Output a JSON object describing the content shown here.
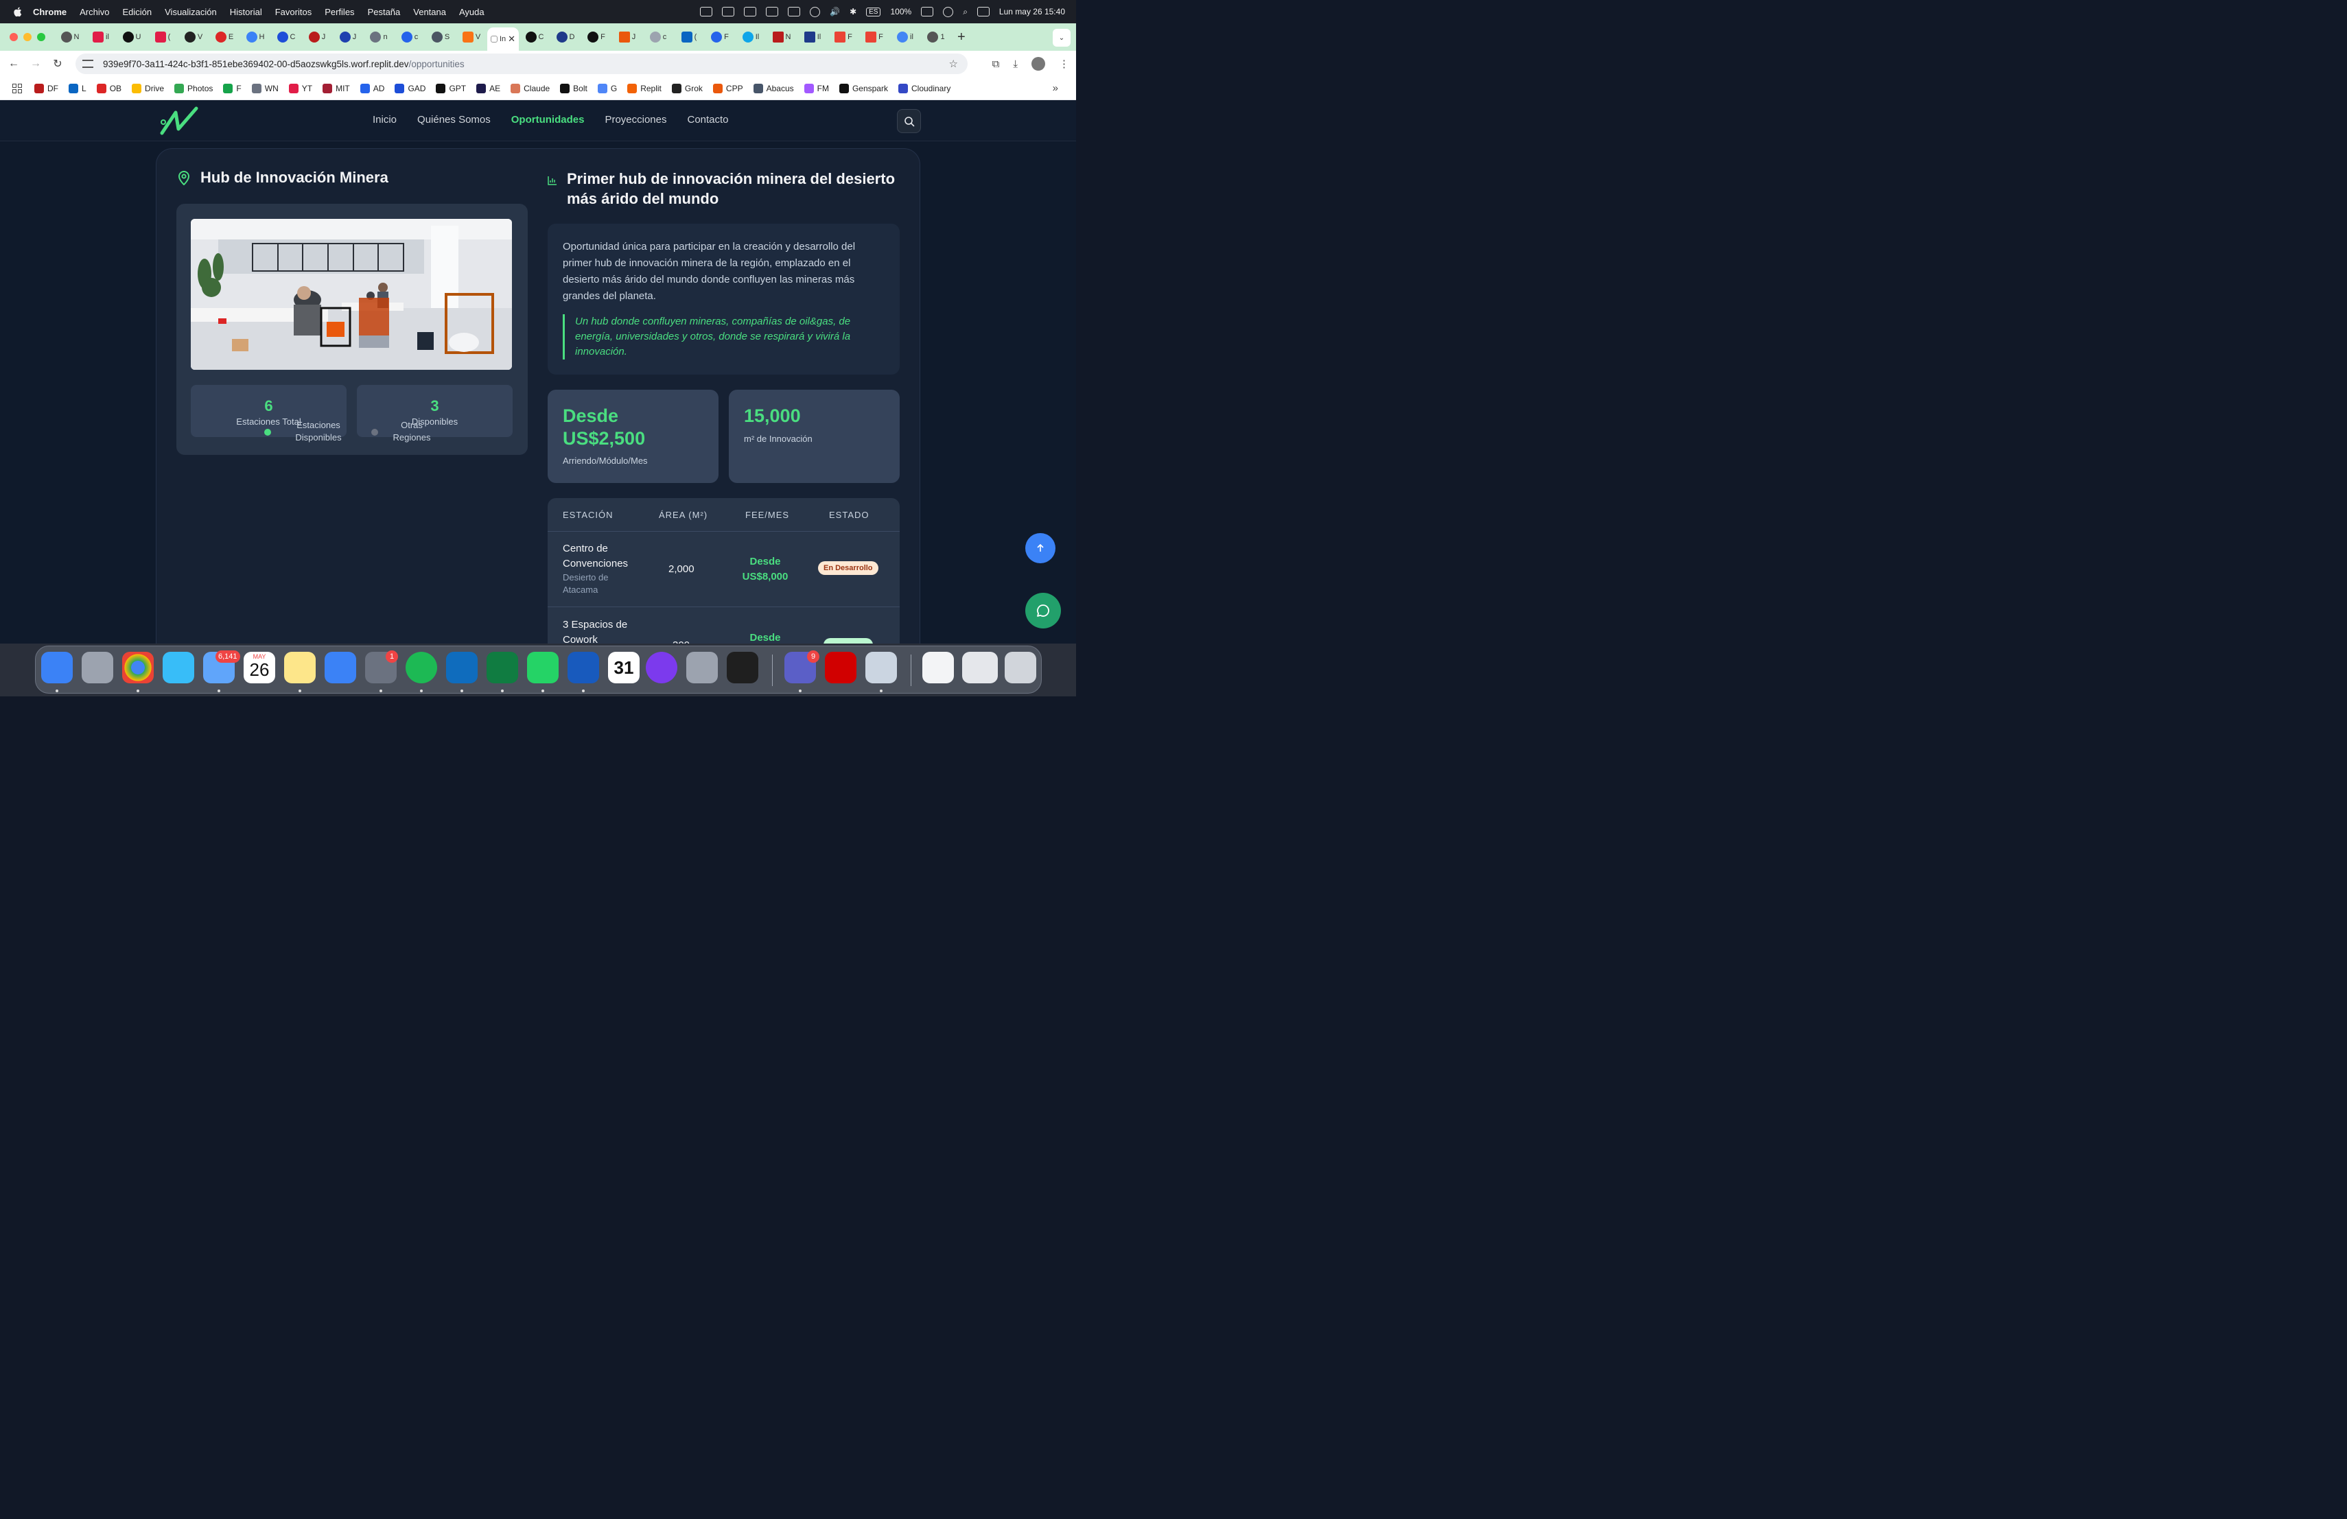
{
  "menubar": {
    "app_name": "Chrome",
    "menus": [
      "Archivo",
      "Edición",
      "Visualización",
      "Historial",
      "Favoritos",
      "Perfiles",
      "Pestaña",
      "Ventana",
      "Ayuda"
    ],
    "input_source": "ES",
    "battery": "100%",
    "datetime": "Lun may 26  15:40"
  },
  "browser": {
    "active_tab_label": "In",
    "tab_labels": [
      "N",
      "il",
      "U",
      "(",
      "V",
      "E",
      "H",
      "C",
      "J",
      "J",
      "n",
      "c",
      "S",
      "V",
      "In",
      "C",
      "D",
      "F",
      "J",
      "c",
      "(",
      "F",
      "Il",
      "N",
      "Il",
      "F",
      "F",
      "il",
      "1"
    ],
    "url_host": "939e9f70-3a11-424c-b3f1-851ebe369402-00-d5aozswkg5ls.worf.replit.dev",
    "url_path": "/opportunities",
    "bookmarks": [
      "DF",
      "L",
      "OB",
      "Drive",
      "Photos",
      "F",
      "WN",
      "YT",
      "MIT",
      "AD",
      "GAD",
      "GPT",
      "AE",
      "Claude",
      "Bolt",
      "G",
      "Replit",
      "Grok",
      "CPP",
      "Abacus",
      "FM",
      "Genspark",
      "Cloudinary"
    ]
  },
  "site": {
    "nav": [
      "Inicio",
      "Quiénes Somos",
      "Oportunidades",
      "Proyecciones",
      "Contacto"
    ],
    "active_nav": "Oportunidades",
    "left_title": "Hub de Innovación Minera",
    "stats": [
      {
        "value": "6",
        "label": "Estaciones Total"
      },
      {
        "value": "3",
        "label": "Disponibles"
      }
    ],
    "legend": [
      {
        "label": "Estaciones Disponibles",
        "color": "#4ade80"
      },
      {
        "label": "Otras Regiones",
        "color": "#6b7280"
      }
    ],
    "right_title": "Primer hub de innovación minera del desierto más árido del mundo",
    "description": "Oportunidad única para participar en la creación y desarrollo del primer hub de innovación minera de la región, emplazado en el desierto más árido del mundo donde confluyen las mineras más grandes del planeta.",
    "quote": "Un hub donde confluyen mineras, compañías de oil&gas, de energía, universidades y otros, donde se respirará y vivirá la innovación.",
    "metrics": [
      {
        "value": "Desde US$2,500",
        "label": "Arriendo/Módulo/Mes"
      },
      {
        "value": "15,000",
        "label": "m² de Innovación"
      }
    ],
    "table": {
      "headers": [
        "ESTACIÓN",
        "ÁREA (M²)",
        "FEE/MES",
        "ESTADO"
      ],
      "rows": [
        {
          "station": "Centro de Convenciones",
          "location": "Desierto de Atacama",
          "area": "2,000",
          "fee": "Desde US$8,000",
          "status": "En Desarrollo",
          "status_color": "#fde8d3"
        },
        {
          "station": "3 Espacios de Cowork",
          "location": "",
          "area": "300",
          "fee": "Desde",
          "status": "",
          "status_color": "#bbf7d0"
        }
      ]
    }
  },
  "dock": {
    "apps": [
      "Finder",
      "Launchpad",
      "Chrome",
      "Safari",
      "Mail",
      "Calendar",
      "Notes",
      "Keynote",
      "System Settings",
      "Spotify",
      "Outlook",
      "Excel",
      "WhatsApp",
      "Word",
      "Calendar 31",
      "Screen Recorder",
      "iPhone Mirroring",
      "Replit",
      "Teams",
      "Acrobat",
      "Preview",
      "Downloads",
      "Trash"
    ],
    "mail_badge": "6,141",
    "settings_badge": "1",
    "teams_badge": "9",
    "calendar_month": "MAY",
    "calendar_day": "26",
    "calendar31": "31"
  }
}
